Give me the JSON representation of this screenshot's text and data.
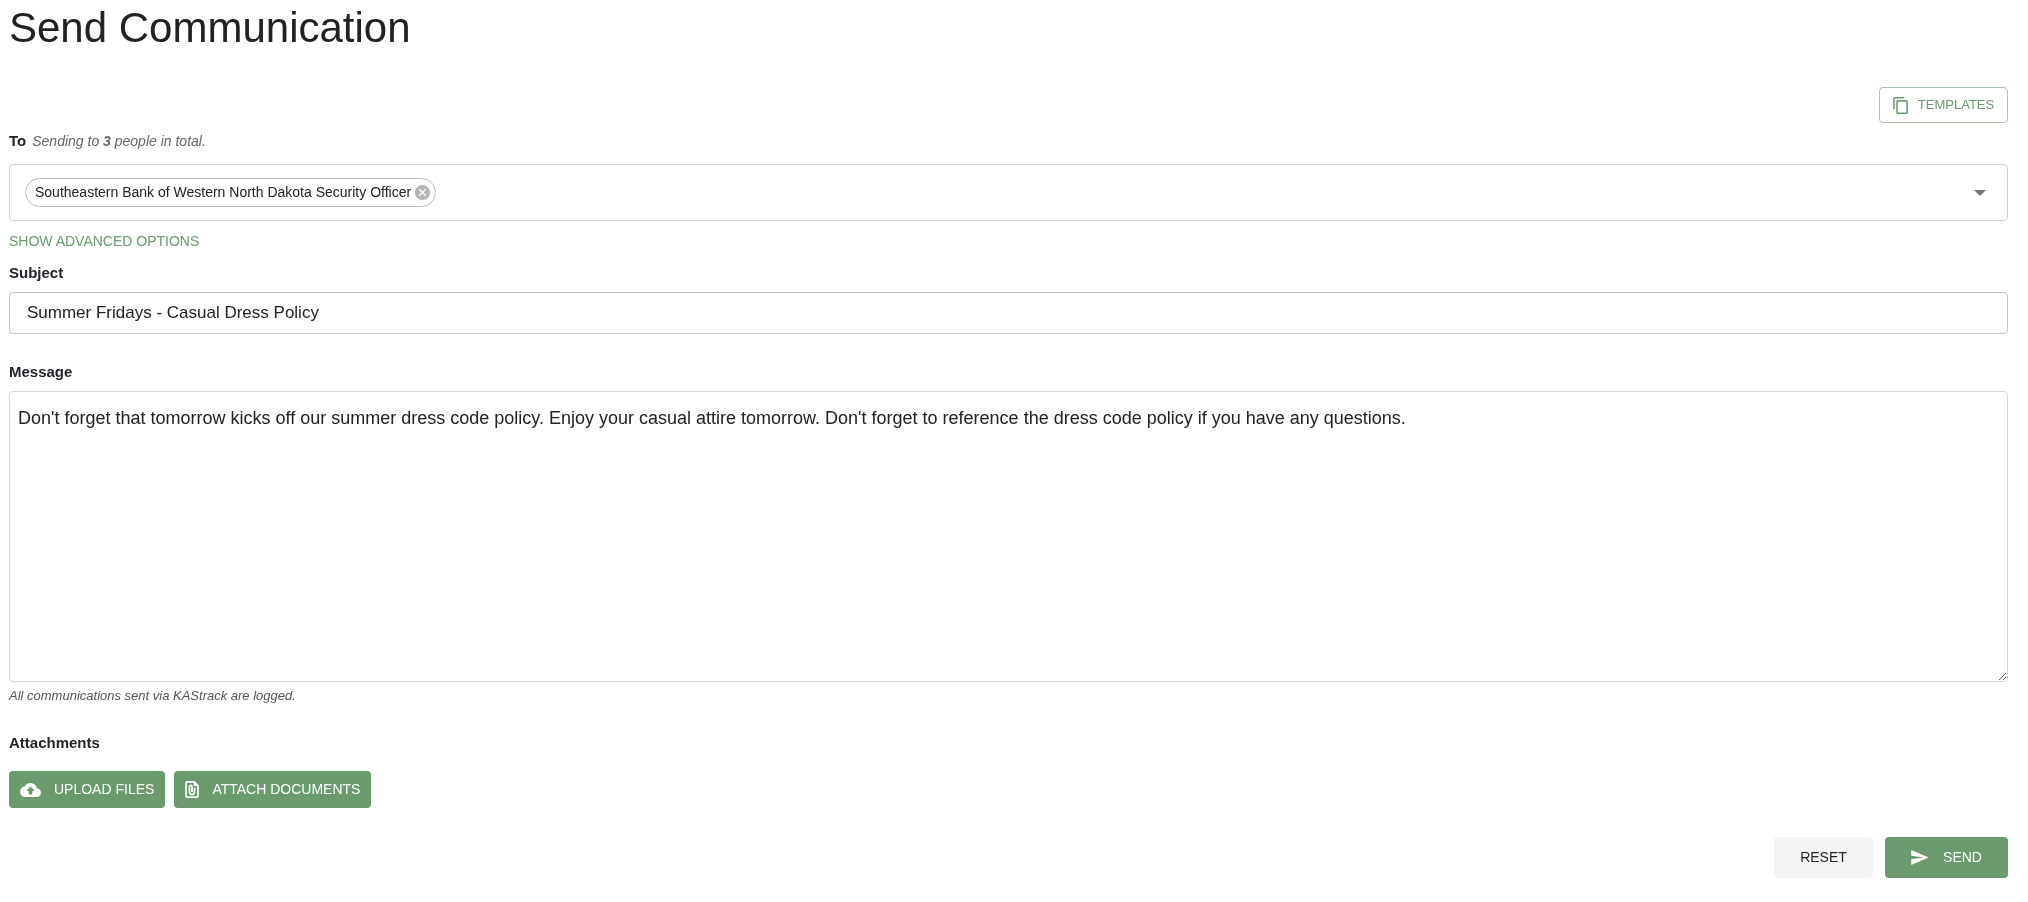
{
  "page": {
    "title": "Send Communication"
  },
  "templates_button": {
    "label": "TEMPLATES"
  },
  "to": {
    "label": "To",
    "summary": "Sending to **3** people in total.",
    "recipients": [
      {
        "label": "Southeastern Bank of Western North Dakota Security Officer"
      }
    ],
    "advanced_link": "SHOW ADVANCED OPTIONS"
  },
  "subject": {
    "label": "Subject",
    "value": "Summer Fridays - Casual Dress Policy"
  },
  "message": {
    "label": "Message",
    "value": "Don't forget that tomorrow kicks off our summer dress code policy. Enjoy your casual attire tomorrow. Don't forget to reference the dress code policy if you have any questions.",
    "note": "All communications sent via KAStrack are logged."
  },
  "attachments": {
    "label": "Attachments",
    "buttons": [
      {
        "label": "UPLOAD FILES",
        "kind": "upload"
      },
      {
        "label": "ATTACH DOCUMENTS",
        "kind": "document"
      }
    ]
  },
  "actions": [
    {
      "label": "RESET",
      "kind": "secondary"
    },
    {
      "label": "SEND",
      "kind": "primary"
    }
  ]
}
